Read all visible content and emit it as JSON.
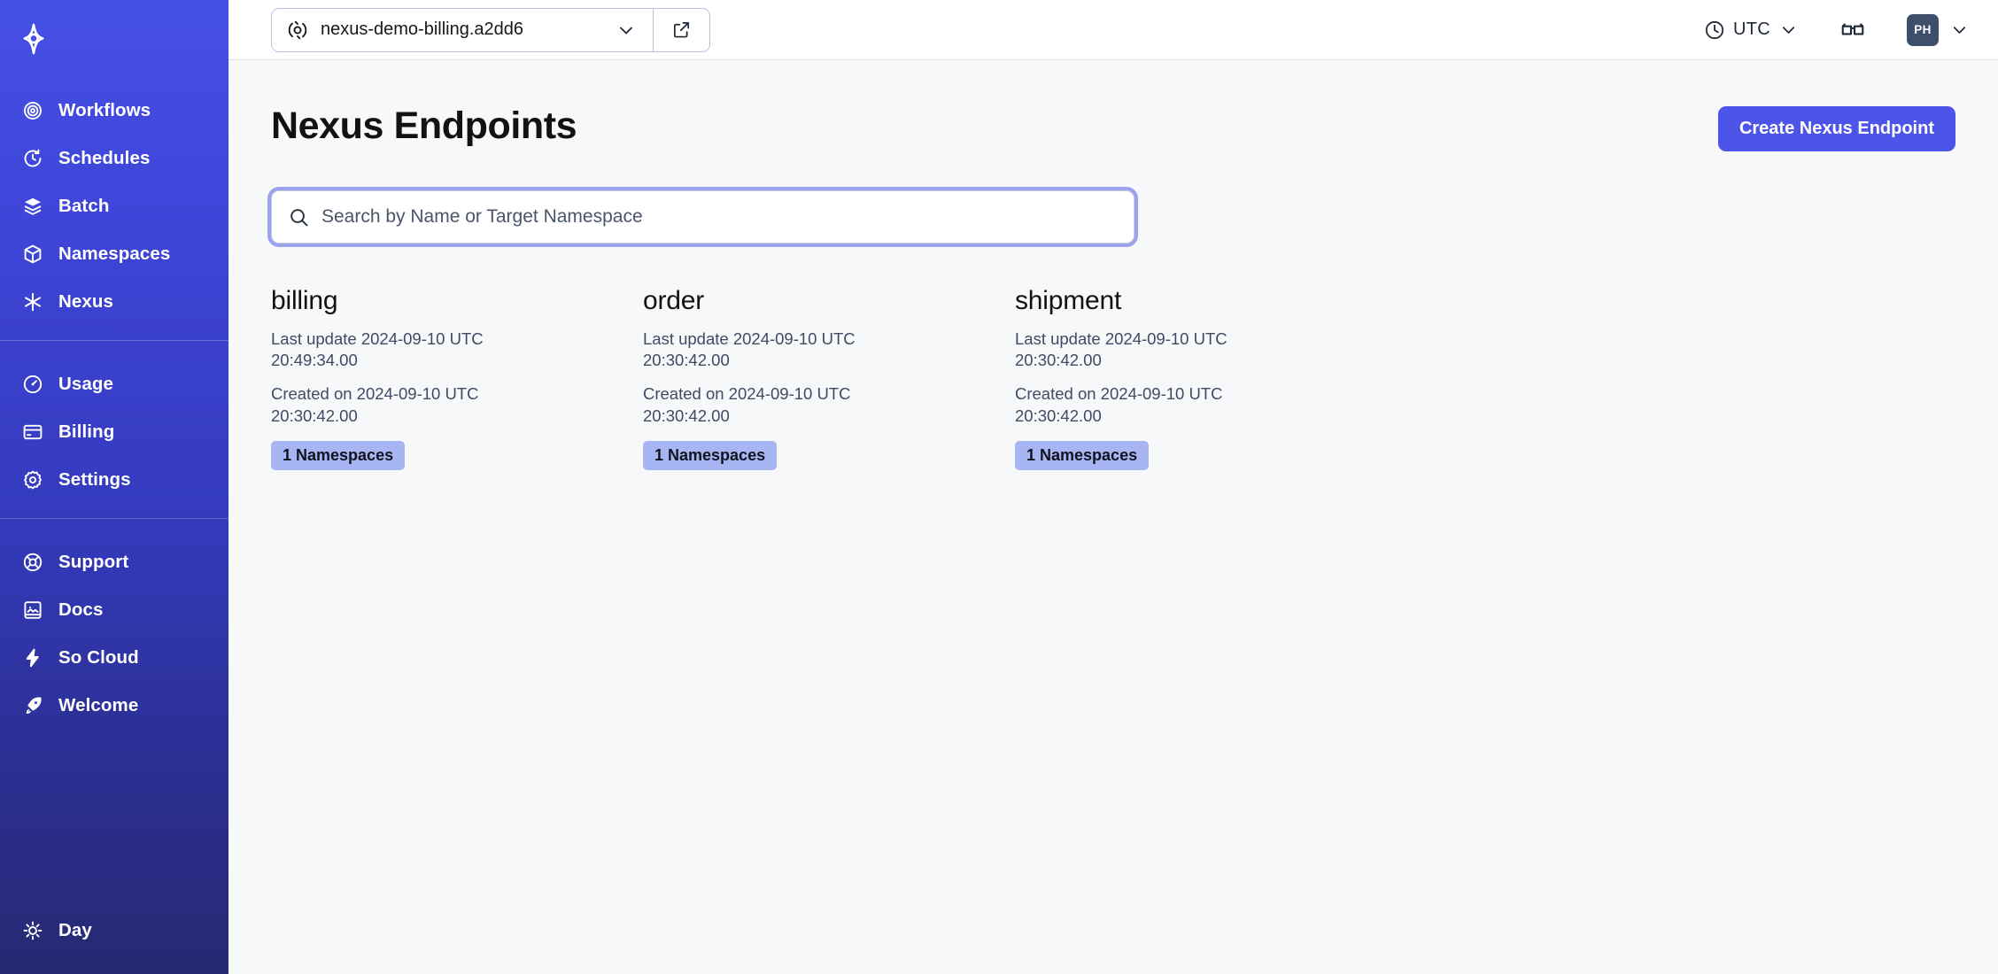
{
  "sidebar": {
    "logo": "temporal-logo",
    "groups": [
      {
        "name": "primary",
        "items": [
          {
            "label": "Workflows",
            "icon": "workflows-icon"
          },
          {
            "label": "Schedules",
            "icon": "schedules-icon"
          },
          {
            "label": "Batch",
            "icon": "batch-icon"
          },
          {
            "label": "Namespaces",
            "icon": "namespaces-icon"
          },
          {
            "label": "Nexus",
            "icon": "nexus-icon"
          }
        ]
      },
      {
        "name": "account",
        "items": [
          {
            "label": "Usage",
            "icon": "usage-icon"
          },
          {
            "label": "Billing",
            "icon": "billing-icon"
          },
          {
            "label": "Settings",
            "icon": "settings-icon"
          }
        ]
      },
      {
        "name": "help",
        "items": [
          {
            "label": "Support",
            "icon": "support-icon"
          },
          {
            "label": "Docs",
            "icon": "docs-icon"
          },
          {
            "label": "So Cloud",
            "icon": "bolt-icon"
          },
          {
            "label": "Welcome",
            "icon": "rocket-icon"
          }
        ]
      }
    ],
    "theme_toggle": {
      "label": "Day",
      "icon": "sun-icon"
    }
  },
  "topbar": {
    "namespace": {
      "value": "nexus-demo-billing.a2dd6",
      "icon": "namespace-icon",
      "caret": "chevron-down-icon",
      "external_link": "external-link-icon"
    },
    "timezone": {
      "label": "UTC",
      "icon": "clock-icon",
      "caret": "chevron-down-icon"
    },
    "glasses": "glasses-icon",
    "user": {
      "initials": "PH",
      "caret": "chevron-down-icon"
    }
  },
  "page": {
    "title": "Nexus Endpoints",
    "create_button": "Create Nexus Endpoint",
    "search": {
      "placeholder": "Search by Name or Target Namespace",
      "value": "",
      "icon": "search-icon"
    },
    "endpoints": [
      {
        "name": "billing",
        "last_update": "Last update 2024-09-10 UTC 20:49:34.00",
        "created": "Created on 2024-09-10 UTC 20:30:42.00",
        "badge": "1 Namespaces"
      },
      {
        "name": "order",
        "last_update": "Last update 2024-09-10 UTC 20:30:42.00",
        "created": "Created on 2024-09-10 UTC 20:30:42.00",
        "badge": "1 Namespaces"
      },
      {
        "name": "shipment",
        "last_update": "Last update 2024-09-10 UTC 20:30:42.00",
        "created": "Created on 2024-09-10 UTC 20:30:42.00",
        "badge": "1 Namespaces"
      }
    ]
  },
  "colors": {
    "sidebar_top": "#4550e6",
    "sidebar_bottom": "#262a72",
    "accent": "#4d55e8",
    "badge_bg": "#a7b5f2",
    "page_bg": "#f7f8fa",
    "focus_ring": "#9ba3ee"
  }
}
